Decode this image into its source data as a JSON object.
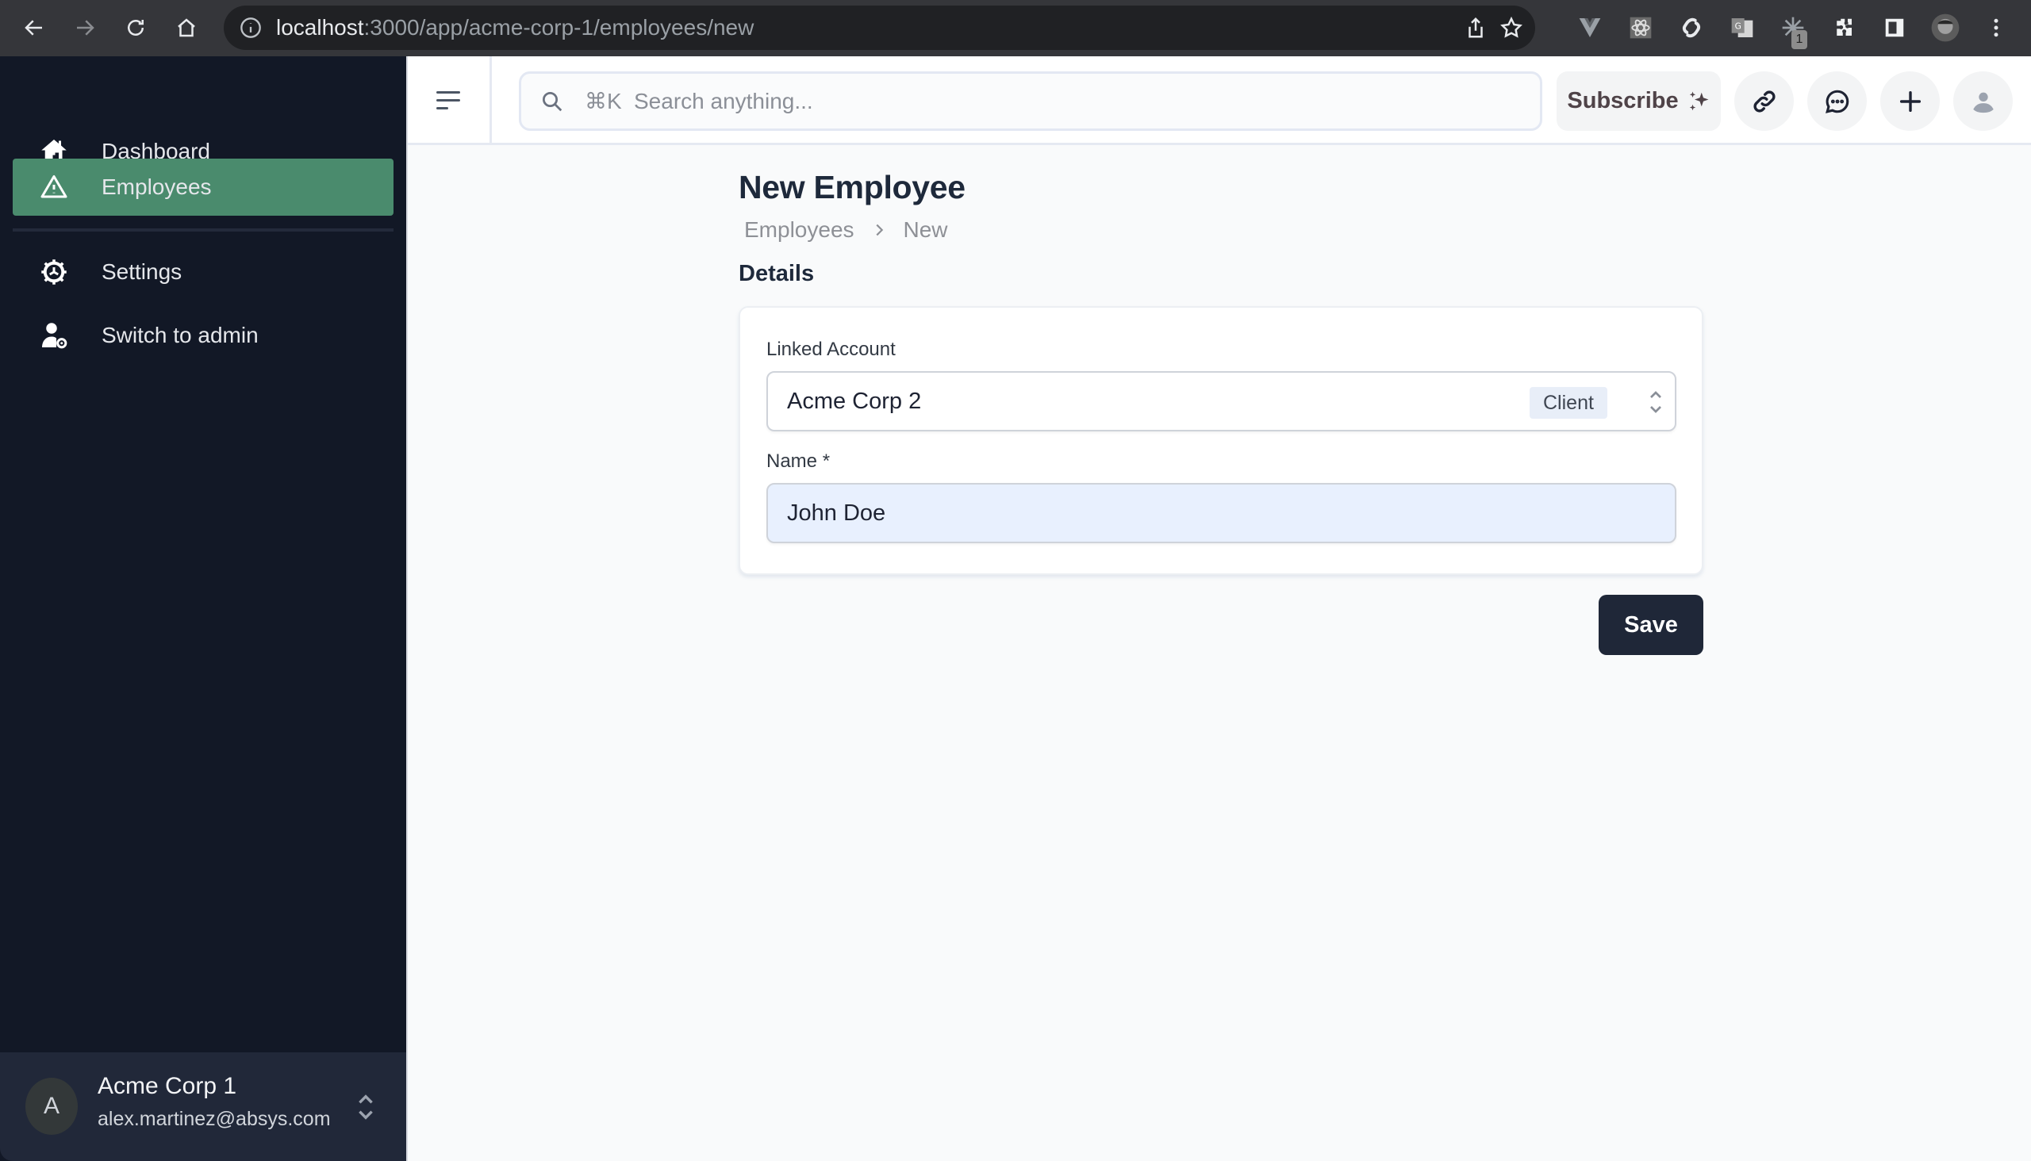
{
  "browser": {
    "url_host": "localhost",
    "url_path": ":3000/app/acme-corp-1/employees/new",
    "extensions": [
      "vue-devtools-icon",
      "react-devtools-icon",
      "svelte-icon",
      "google-translate-icon",
      "extension-sparkle-icon",
      "puzzle-icon",
      "side-panel-icon",
      "profile-avatar-icon",
      "kebab-menu-icon"
    ],
    "extension_badge": "1"
  },
  "sidebar": {
    "items": [
      {
        "label": "Dashboard",
        "icon": "home-icon",
        "active": false
      },
      {
        "label": "Employees",
        "icon": "warning-triangle-icon",
        "active": true
      },
      {
        "label": "Settings",
        "icon": "gear-icon",
        "active": false
      },
      {
        "label": "Switch to admin",
        "icon": "user-cog-icon",
        "active": false
      }
    ],
    "org": {
      "avatar_letter": "A",
      "name": "Acme Corp 1",
      "email": "alex.martinez@absys.com"
    }
  },
  "topbar": {
    "search_shortcut": "⌘K",
    "search_placeholder": "Search anything...",
    "subscribe_label": "Subscribe"
  },
  "page": {
    "title": "New Employee",
    "breadcrumb": [
      "Employees",
      "New"
    ],
    "section_title": "Details",
    "form": {
      "linked_account_label": "Linked Account",
      "linked_account_value": "Acme Corp 2",
      "linked_account_tag": "Client",
      "name_label": "Name *",
      "name_value": "John Doe"
    },
    "save_label": "Save"
  },
  "colors": {
    "sidebar_bg": "#121826",
    "active_item": "#4a8b6d",
    "primary_button": "#1f2738",
    "input_autofill": "#e8f0fe"
  }
}
